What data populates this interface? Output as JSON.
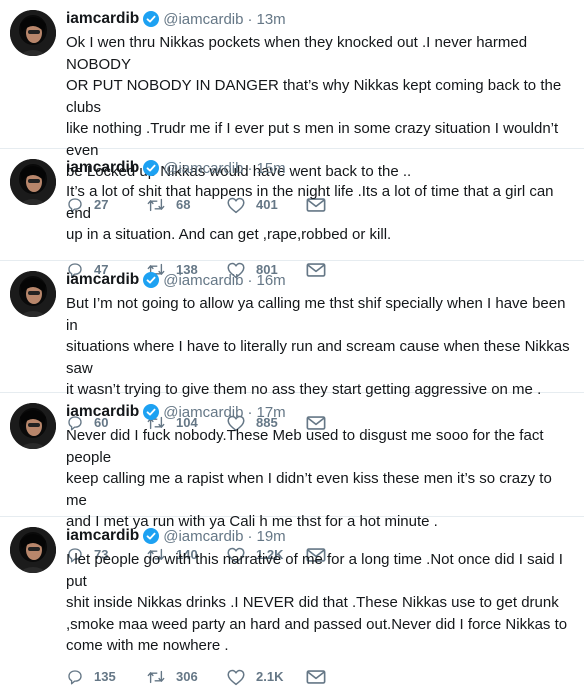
{
  "colors": {
    "text": "#14171a",
    "secondary": "#657786",
    "verified": "#1da1f2",
    "divider": "#e6ecf0"
  },
  "tweets": [
    {
      "name": "iamcardib",
      "handle": "@iamcardib",
      "time": "13m",
      "lines": [
        "Ok I wen thru Nikkas pockets when they knocked out .I never harmed NOBODY",
        "OR PUT NOBODY IN DANGER that’s why Nikkas kept coming back to the clubs",
        "like nothing .Trudr me if I ever put s men in some crazy situation I wouldn’t even",
        "be Locked up Nikkas would have went back to the .."
      ],
      "replies": "27",
      "retweets": "68",
      "likes": "401"
    },
    {
      "name": "iamcardib",
      "handle": "@iamcardib",
      "time": "15m",
      "lines": [
        "It’s a lot of shit that happens in the night life .Its a lot of time that a girl can end",
        "up in a situation. And can get ,rape,robbed or kill."
      ],
      "replies": "47",
      "retweets": "138",
      "likes": "801"
    },
    {
      "name": "iamcardib",
      "handle": "@iamcardib",
      "time": "16m",
      "lines": [
        "But I’m not going to allow ya calling me thst shif specially when I have been in",
        "situations where I have to literally run and scream cause when these Nikkas saw",
        "it wasn’t trying to give them no ass they start getting aggressive on me ."
      ],
      "replies": "60",
      "retweets": "104",
      "likes": "885"
    },
    {
      "name": "iamcardib",
      "handle": "@iamcardib",
      "time": "17m",
      "lines": [
        "Never did I fuck nobody.These Meb used to disgust me sooo for the fact people",
        "keep calling me a rapist when I didn’t even kiss these men it’s so crazy to me",
        "and I met ya run with ya Cali h me thst for a hot minute ."
      ],
      "replies": "73",
      "retweets": "140",
      "likes": "1.2K"
    },
    {
      "name": "iamcardib",
      "handle": "@iamcardib",
      "time": "19m",
      "lines": [
        "I let people go with this narrative of me for a long time .Not once did I said I put",
        "shit inside Nikkas drinks .I NEVER did that .These Nikkas use to get drunk",
        ",smoke maa weed party an hard and passed out.Never did I force Nikkas to",
        "come with me nowhere ."
      ],
      "replies": "135",
      "retweets": "306",
      "likes": "2.1K"
    }
  ]
}
